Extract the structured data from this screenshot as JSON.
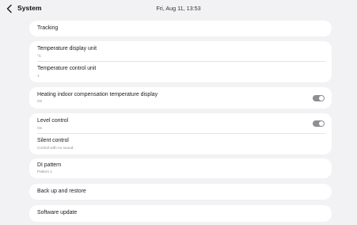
{
  "header": {
    "title": "System",
    "datetime": "Fri, Aug 11, 13:53"
  },
  "settings": {
    "tracking": {
      "title": "Tracking"
    },
    "temp_display_unit": {
      "title": "Temperature display unit",
      "value": "°C"
    },
    "temp_control_unit": {
      "title": "Temperature control unit",
      "value": "1"
    },
    "heating_compensation": {
      "title": "Heating indoor compensation temperature display",
      "value": "On",
      "toggle_on": true
    },
    "level_control": {
      "title": "Level control",
      "value": "On",
      "toggle_on": true
    },
    "silent_control": {
      "title": "Silent control",
      "value": "Control with no sound."
    },
    "di_pattern": {
      "title": "DI pattern",
      "value": "Pattern 1"
    },
    "backup_restore": {
      "title": "Back up and restore"
    },
    "software_update": {
      "title": "Software update"
    }
  },
  "icons": {
    "back": "chevron-left-icon",
    "toggle": "toggle-switch-icon"
  },
  "colors": {
    "background": "#f2f2f4",
    "card": "#ffffff",
    "toggle": "#8e8e93"
  }
}
